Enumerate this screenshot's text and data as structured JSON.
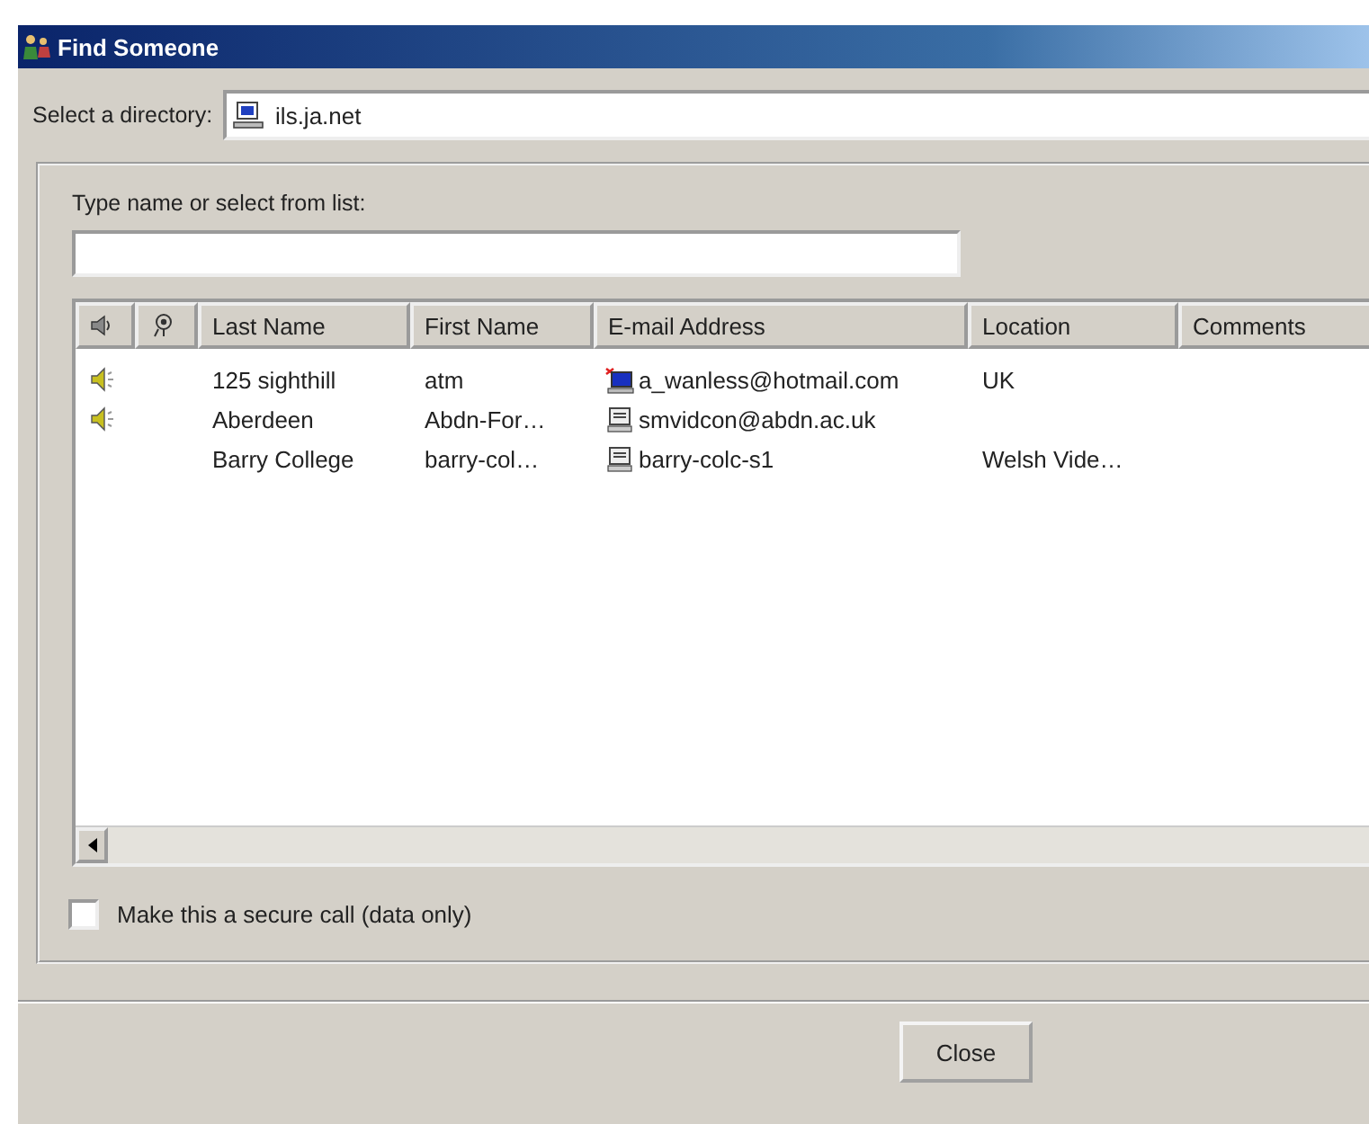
{
  "window": {
    "title": "Find Someone"
  },
  "directory": {
    "label": "Select a directory:",
    "value": "ils.ja.net"
  },
  "search": {
    "label": "Type name or select from list:"
  },
  "table": {
    "columns": [
      {
        "kind": "audio-icon"
      },
      {
        "kind": "video-icon"
      },
      {
        "kind": "text",
        "label": "Last Name"
      },
      {
        "kind": "text",
        "label": "First Name"
      },
      {
        "kind": "text",
        "label": "E-mail Address"
      },
      {
        "kind": "text",
        "label": "Location"
      },
      {
        "kind": "text",
        "label": "Comments"
      }
    ],
    "rows": [
      {
        "audio": true,
        "kind": "active",
        "last_name": "125 sighthill",
        "first_name": "atm",
        "email": "a_wanless@hotmail.com",
        "location": "UK"
      },
      {
        "audio": true,
        "kind": "plain",
        "last_name": "Aberdeen",
        "first_name": "Abdn-For…",
        "email": "smvidcon@abdn.ac.uk"
      },
      {
        "audio": false,
        "kind": "plain",
        "last_name": "Barry College",
        "first_name": "barry-col…",
        "email": "barry-colc-s1",
        "location": "Welsh Vide…"
      }
    ]
  },
  "secure_call": {
    "label": "Make this a secure call (data only)",
    "checked": false
  },
  "buttons": [
    {
      "label": "Close"
    }
  ]
}
